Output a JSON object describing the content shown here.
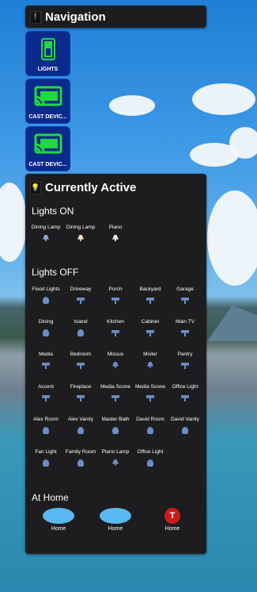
{
  "navigation": {
    "title": "Navigation",
    "tiles": [
      {
        "label": "LIGHTS",
        "icon": "light-switch-icon"
      },
      {
        "label": "CAST DEVIC...",
        "icon": "cast-icon"
      },
      {
        "label": "CAST DEVIC...",
        "icon": "cast-icon"
      }
    ]
  },
  "active": {
    "title": "Currently Active",
    "lights_on_title": "Lights ON",
    "lights_on": [
      {
        "name": "Dining Lamp",
        "icon": "table-lamp-icon"
      },
      {
        "name": "Dining Lamp",
        "icon": "table-lamp-icon"
      },
      {
        "name": "Piano",
        "icon": "piano-lamp-icon"
      }
    ],
    "lights_off_title": "Lights OFF",
    "lights_off": [
      {
        "name": "Flood Lights",
        "icon": "ceiling-light-icon"
      },
      {
        "name": "Driveway",
        "icon": "spotlight-icon"
      },
      {
        "name": "Porch",
        "icon": "spotlight-icon"
      },
      {
        "name": "Backyard",
        "icon": "spotlight-icon"
      },
      {
        "name": "Garage",
        "icon": "spotlight-icon"
      },
      {
        "name": "Dining",
        "icon": "ceiling-light-icon"
      },
      {
        "name": "Island",
        "icon": "ceiling-light-icon"
      },
      {
        "name": "Kitchen",
        "icon": "spotlight-icon"
      },
      {
        "name": "Cabinet",
        "icon": "spotlight-icon"
      },
      {
        "name": "Main TV",
        "icon": "spotlight-icon"
      },
      {
        "name": "Media",
        "icon": "spotlight-icon"
      },
      {
        "name": "Bedroom",
        "icon": "spotlight-icon"
      },
      {
        "name": "Missus",
        "icon": "table-lamp-icon"
      },
      {
        "name": "Mister",
        "icon": "table-lamp-icon"
      },
      {
        "name": "Pantry",
        "icon": "spotlight-icon"
      },
      {
        "name": "Accent",
        "icon": "led-strip-icon"
      },
      {
        "name": "Fireplace",
        "icon": "led-strip-icon"
      },
      {
        "name": "Media Scone",
        "icon": "led-strip-icon"
      },
      {
        "name": "Media Scone",
        "icon": "led-strip-icon"
      },
      {
        "name": "Office Light",
        "icon": "led-strip-icon"
      },
      {
        "name": "Alex Room",
        "icon": "ceiling-light-icon"
      },
      {
        "name": "Alex Vanity",
        "icon": "ceiling-light-icon"
      },
      {
        "name": "Master Bath",
        "icon": "ceiling-light-icon"
      },
      {
        "name": "David Room",
        "icon": "ceiling-light-icon"
      },
      {
        "name": "David Vanity",
        "icon": "ceiling-light-icon"
      },
      {
        "name": "Fan Light",
        "icon": "ceiling-light-icon"
      },
      {
        "name": "Family Room",
        "icon": "ceiling-light-icon"
      },
      {
        "name": "Piano Lamp",
        "icon": "table-lamp-icon"
      },
      {
        "name": "Office Light",
        "icon": "ceiling-light-icon"
      }
    ],
    "at_home_title": "At Home",
    "people": [
      {
        "label": "Home",
        "avatar": "redacted-avatar"
      },
      {
        "label": "Home",
        "avatar": "redacted-avatar"
      },
      {
        "label": "Home",
        "avatar": "tesla-logo-icon"
      }
    ]
  },
  "colors": {
    "card": "#1d1d1f",
    "tile": "#0a2a8c",
    "icon_green": "#21d93a",
    "icon_off": "#6b8ec7",
    "tesla_red": "#cc1b1b"
  }
}
